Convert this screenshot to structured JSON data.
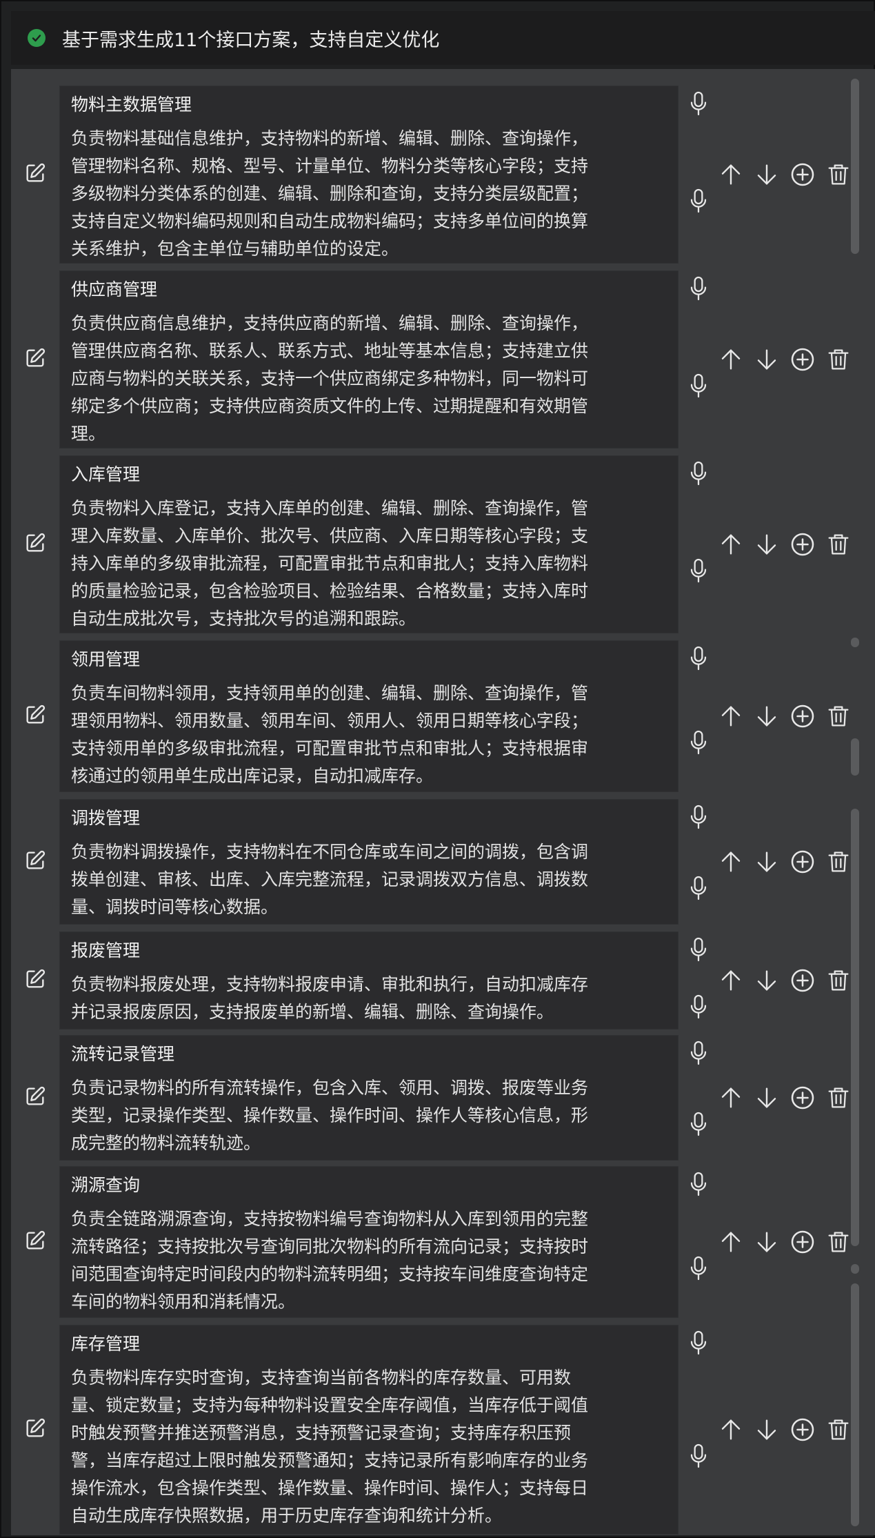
{
  "header": {
    "title": "基于需求生成11个接口方案，支持自定义优化",
    "status_icon": "check-circle-icon",
    "status_color": "#2e9d4d"
  },
  "modules": [
    {
      "title": "物料主数据管理",
      "lines": [
        "负责物料基础信息维护，支持物料的新增、编辑、删除、查询操作，",
        "管理物料名称、规格、型号、计量单位、物料分类等核心字段；支持",
        "多级物料分类体系的创建、编辑、删除和查询，支持分类层级配置；",
        "支持自定义物料编码规则和自动生成物料编码；支持多单位间的换算",
        "关系维护，包含主单位与辅助单位的设定。"
      ]
    },
    {
      "title": "供应商管理",
      "lines": [
        "负责供应商信息维护，支持供应商的新增、编辑、删除、查询操作，",
        "管理供应商名称、联系人、联系方式、地址等基本信息；支持建立供",
        "应商与物料的关联关系，支持一个供应商绑定多种物料，同一物料可",
        "绑定多个供应商；支持供应商资质文件的上传、过期提醒和有效期管",
        "理。"
      ]
    },
    {
      "title": "入库管理",
      "lines": [
        "负责物料入库登记，支持入库单的创建、编辑、删除、查询操作，管",
        "理入库数量、入库单价、批次号、供应商、入库日期等核心字段；支",
        "持入库单的多级审批流程，可配置审批节点和审批人；支持入库物料",
        "的质量检验记录，包含检验项目、检验结果、合格数量；支持入库时",
        "自动生成批次号，支持批次号的追溯和跟踪。"
      ]
    },
    {
      "title": "领用管理",
      "lines": [
        "负责车间物料领用，支持领用单的创建、编辑、删除、查询操作，管",
        "理领用物料、领用数量、领用车间、领用人、领用日期等核心字段；",
        "支持领用单的多级审批流程，可配置审批节点和审批人；支持根据审",
        "核通过的领用单生成出库记录，自动扣减库存。"
      ]
    },
    {
      "title": "调拨管理",
      "lines": [
        "负责物料调拨操作，支持物料在不同仓库或车间之间的调拨，包含调",
        "拨单创建、审核、出库、入库完整流程，记录调拨双方信息、调拨数",
        "量、调拨时间等核心数据。"
      ]
    },
    {
      "title": "报废管理",
      "lines": [
        "负责物料报废处理，支持物料报废申请、审批和执行，自动扣减库存",
        "并记录报废原因，支持报废单的新增、编辑、删除、查询操作。"
      ]
    },
    {
      "title": "流转记录管理",
      "lines": [
        "负责记录物料的所有流转操作，包含入库、领用、调拨、报废等业务",
        "类型，记录操作类型、操作数量、操作时间、操作人等核心信息，形",
        "成完整的物料流转轨迹。"
      ]
    },
    {
      "title": "溯源查询",
      "lines": [
        "负责全链路溯源查询，支持按物料编号查询物料从入库到领用的完整",
        "流转路径；支持按批次号查询同批次物料的所有流向记录；支持按时",
        "间范围查询特定时间段内的物料流转明细；支持按车间维度查询特定",
        "车间的物料领用和消耗情况。"
      ]
    },
    {
      "title": "库存管理",
      "lines": [
        "负责物料库存实时查询，支持查询当前各物料的库存数量、可用数",
        "量、锁定数量；支持为每种物料设置安全库存阈值，当库存低于阈值",
        "时触发预警并推送预警消息，支持预警记录查询；支持库存积压预",
        "警，当库存超过上限时触发预警通知；支持记录所有影响库存的业务",
        "操作流水，包含操作类型、操作数量、操作时间、操作人；支持每日",
        "自动生成库存快照数据，用于历史库存查询和统计分析。"
      ]
    }
  ],
  "icons": {
    "edit": "edit-icon",
    "mic": "microphone-icon",
    "up": "arrow-up-icon",
    "down": "arrow-down-icon",
    "add": "plus-circle-icon",
    "delete": "trash-icon"
  }
}
